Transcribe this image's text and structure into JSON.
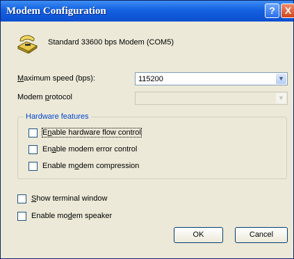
{
  "window": {
    "title": "Modem Configuration",
    "help_glyph": "?",
    "close_glyph": "X"
  },
  "modem": {
    "name": "Standard 33600 bps Modem (COM5)",
    "icon": "modem-icon"
  },
  "fields": {
    "max_speed": {
      "label_pre": "",
      "label_key": "M",
      "label_post": "aximum speed (bps):",
      "value": "115200"
    },
    "protocol": {
      "label_pre": "Modem ",
      "label_key": "p",
      "label_post": "rotocol",
      "value": ""
    }
  },
  "hardware": {
    "title": "Hardware features",
    "options": [
      {
        "pre": "E",
        "key": "n",
        "post": "able hardware flow control",
        "checked": false
      },
      {
        "pre": "En",
        "key": "a",
        "post": "ble modem error control",
        "checked": false
      },
      {
        "pre": "Enable m",
        "key": "o",
        "post": "dem compression",
        "checked": false
      }
    ]
  },
  "options": {
    "show_terminal": {
      "pre": "",
      "key": "S",
      "post": "how terminal window",
      "checked": false
    },
    "speaker": {
      "pre": "Enable mo",
      "key": "d",
      "post": "em speaker",
      "checked": false
    }
  },
  "buttons": {
    "ok": "OK",
    "cancel": "Cancel"
  },
  "colors": {
    "titlebar": "#0b4fd0",
    "group_title": "#0046d5",
    "face": "#ece9d8"
  }
}
